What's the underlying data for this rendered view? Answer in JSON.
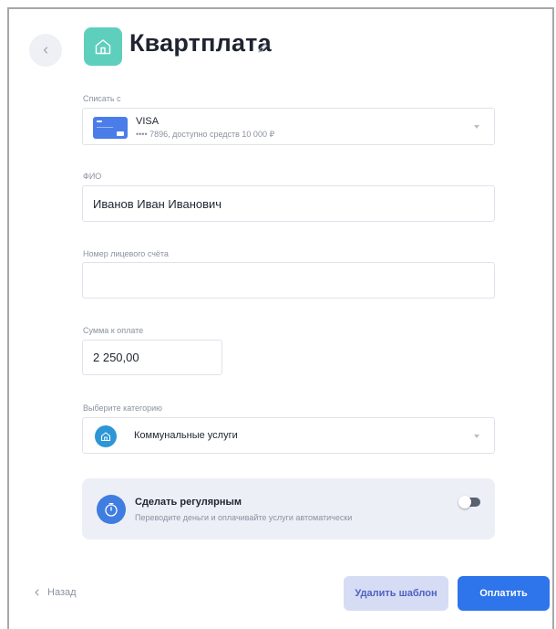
{
  "header": {
    "title": "Квартплата"
  },
  "debit_from": {
    "label": "Списать с",
    "card_brand": "VISA",
    "card_details": "•••• 7896, доступно средств 10 000 ₽"
  },
  "full_name": {
    "label": "ФИО",
    "value": "Иванов Иван Иванович"
  },
  "account_number": {
    "label": "Номер лицевого счёта",
    "value": ""
  },
  "amount": {
    "label": "Сумма к оплате",
    "value": "2 250,00"
  },
  "category": {
    "label": "Выберите категорию",
    "value": "Коммунальные услуги"
  },
  "regular": {
    "title": "Сделать регулярным",
    "subtitle": "Переводите деньги и оплачивайте услуги автоматически",
    "enabled": false
  },
  "footer": {
    "back_label": "Назад",
    "delete_label": "Удалить шаблон",
    "pay_label": "Оплатить"
  },
  "colors": {
    "accent": "#2e74ea",
    "house_tile": "#5fcfbd",
    "category_icon": "#2d96d6",
    "delete_button_bg": "#d6dcf4"
  }
}
